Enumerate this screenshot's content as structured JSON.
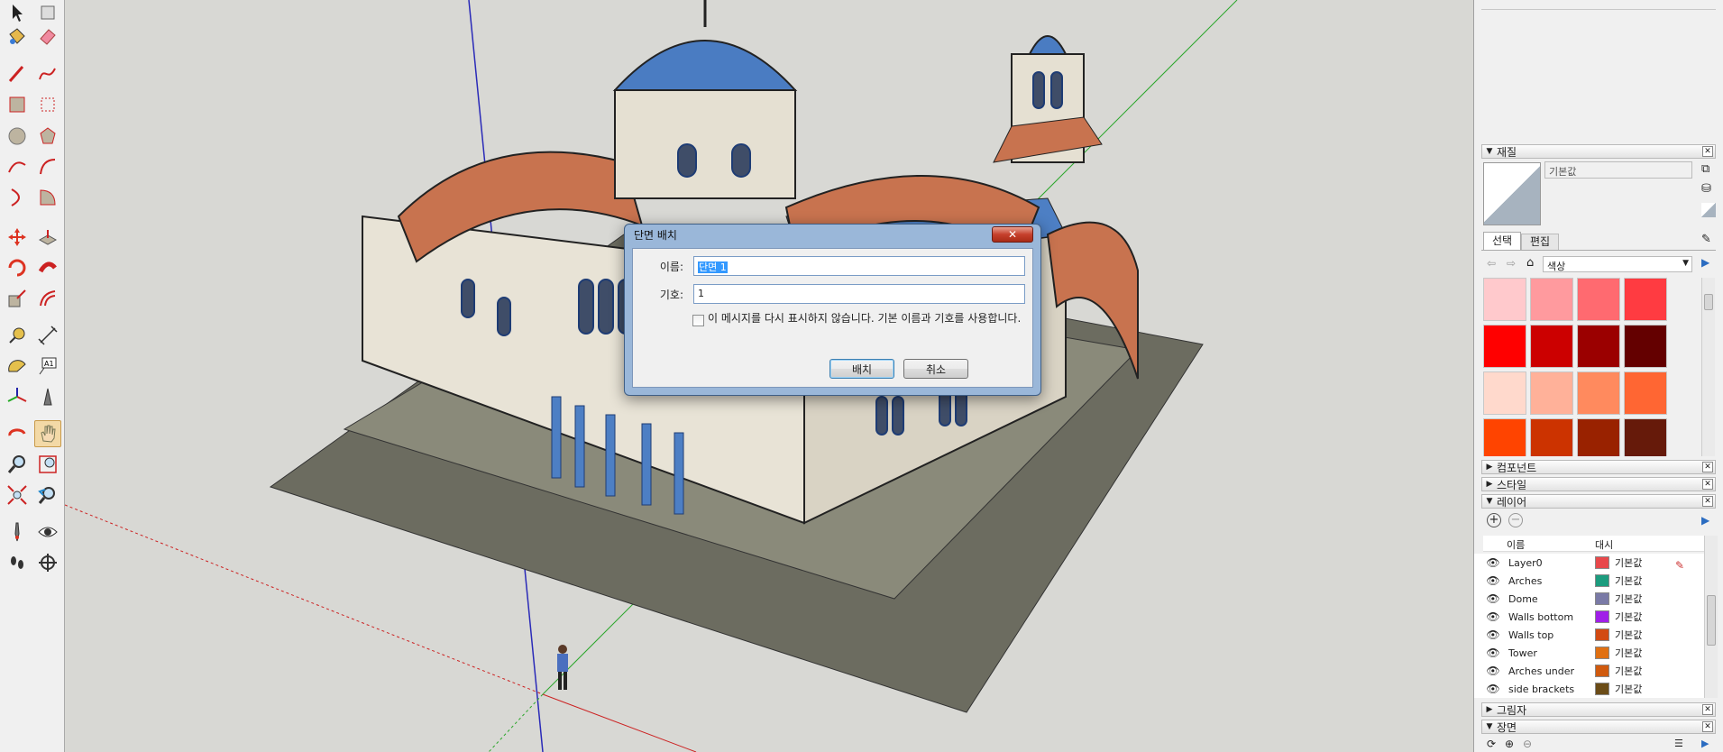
{
  "dialog": {
    "title": "단면 배치",
    "close_label": "✕",
    "name_label": "이름:",
    "name_value": "단면 1",
    "symbol_label": "기호:",
    "symbol_value": "1",
    "checkbox_text": "이 메시지를 다시 표시하지 않습니다. 기본 이름과 기호를 사용합니다.",
    "place_button": "배치",
    "cancel_button": "취소"
  },
  "tray": {
    "materials": {
      "title": "재질",
      "material_name": "기본값",
      "tab_select": "선택",
      "tab_edit": "편집",
      "library": "색상",
      "swatches": [
        "#ffc9cc",
        "#ff9a9e",
        "#ff6a70",
        "#ff3b41",
        "#ff0000",
        "#cc0000",
        "#9b0000",
        "#640000",
        "#ffd9cc",
        "#ffb199",
        "#ff8a5e",
        "#ff6633",
        "#ff4400",
        "#cc3300",
        "#992200",
        "#661a0a"
      ]
    },
    "components": {
      "title": "컴포넌트"
    },
    "styles": {
      "title": "스타일"
    },
    "layers": {
      "title": "레이어",
      "col_name": "이름",
      "col_dash": "대시",
      "rows": [
        {
          "name": "Layer0",
          "color": "#e8484b",
          "dash": "기본값"
        },
        {
          "name": "Arches",
          "color": "#1c9c7e",
          "dash": "기본값"
        },
        {
          "name": "Dome",
          "color": "#7a7aa6",
          "dash": "기본값"
        },
        {
          "name": "Walls bottom",
          "color": "#a01fe8",
          "dash": "기본값"
        },
        {
          "name": "Walls top",
          "color": "#d24a12",
          "dash": "기본값"
        },
        {
          "name": "Tower",
          "color": "#e07012",
          "dash": "기본값"
        },
        {
          "name": "Arches under",
          "color": "#d05a0e",
          "dash": "기본값"
        },
        {
          "name": "side brackets",
          "color": "#6b4c17",
          "dash": "기본값"
        }
      ]
    },
    "shadows": {
      "title": "그림자"
    },
    "scenes": {
      "title": "장면"
    }
  },
  "toolbar": {
    "tools": [
      "select-tool",
      "paint-tool",
      "eraser-tool",
      "pencil-tool",
      "freehand-tool",
      "rectangle-tool",
      "rotated-rectangle-tool",
      "circle-tool",
      "polygon-tool",
      "arc-tool",
      "pie-tool",
      "move-tool",
      "pushpull-tool",
      "rotate-tool",
      "followme-tool",
      "scale-tool",
      "offset-tool",
      "tape-measure-tool",
      "dimension-tool",
      "protractor-tool",
      "text-tool",
      "axes-tool",
      "3dtext-tool",
      "orbit-tool",
      "pan-tool",
      "zoom-tool",
      "zoom-window-tool",
      "zoom-extents-tool",
      "previous-tool",
      "position-camera-tool",
      "lookaround-tool",
      "walk-tool",
      "section-plane-tool"
    ]
  }
}
